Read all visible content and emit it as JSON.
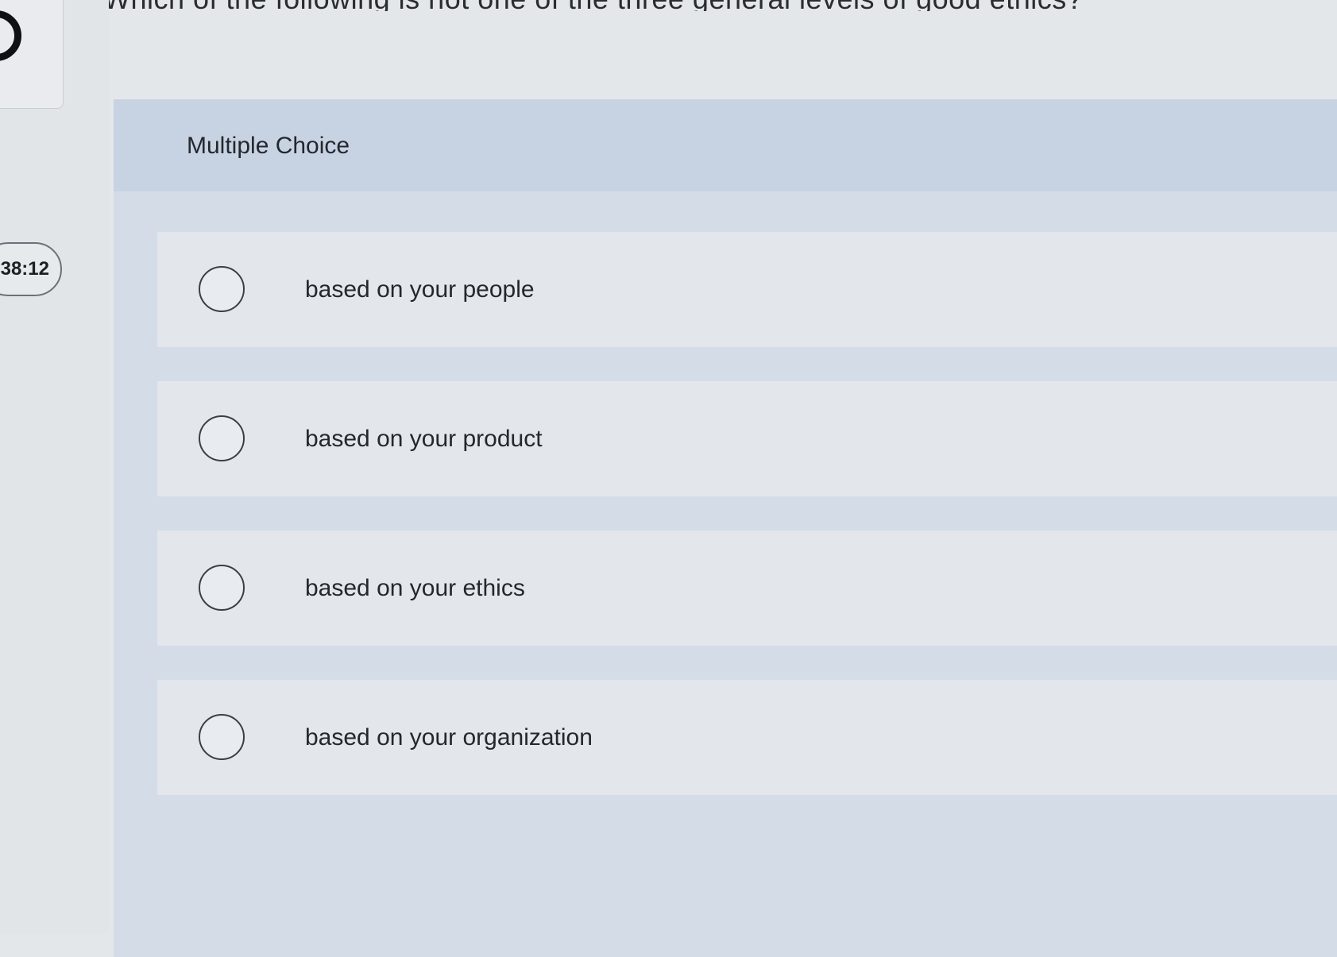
{
  "question": {
    "text": "Which of the following is not one of the three general levels of good ethics?"
  },
  "timer": {
    "value": "38:12"
  },
  "card": {
    "title": "Multiple Choice"
  },
  "options": [
    {
      "label": "based on your people"
    },
    {
      "label": "based on your product"
    },
    {
      "label": "based on your ethics"
    },
    {
      "label": "based on your organization"
    }
  ],
  "colors": {
    "header_bg": "#c7d2e3",
    "card_bg": "#d4dce8",
    "option_bg": "#e3e7ec",
    "text": "#24272c"
  }
}
